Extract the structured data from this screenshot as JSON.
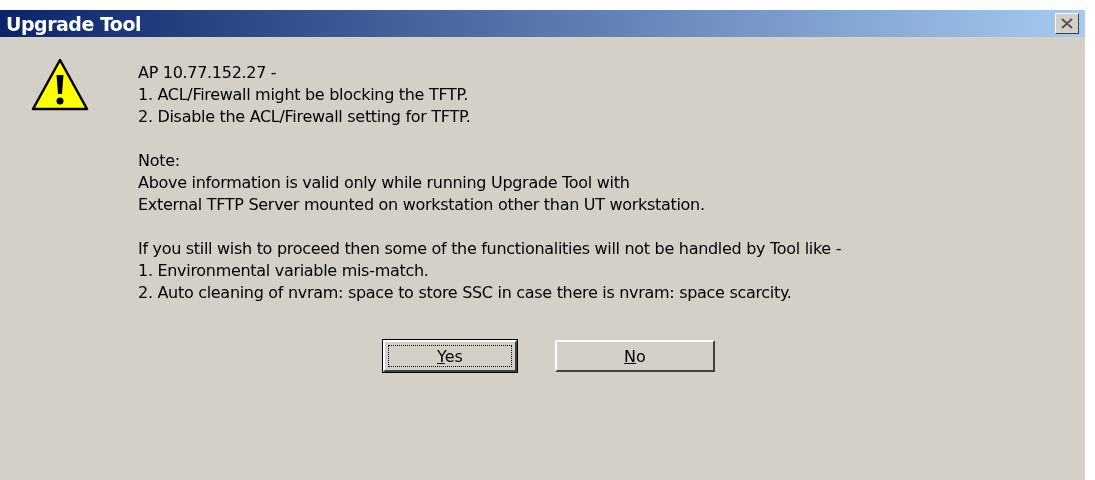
{
  "window": {
    "title": "Upgrade Tool"
  },
  "message": {
    "paragraphs": [
      [
        "AP 10.77.152.27 -",
        "1. ACL/Firewall might be blocking the TFTP.",
        "2. Disable the ACL/Firewall setting for TFTP."
      ],
      [
        "Note:",
        "Above information is valid only while running Upgrade Tool with",
        "External TFTP Server mounted on workstation other than UT workstation."
      ],
      [
        "If you still wish to proceed then some of the functionalities will not be handled by Tool like -",
        "1. Environmental variable mis-match.",
        "2. Auto cleaning of nvram: space to store SSC in case there is nvram: space scarcity."
      ]
    ]
  },
  "buttons": [
    {
      "mnemonic": "Y",
      "rest": "es",
      "default": true
    },
    {
      "mnemonic": "N",
      "rest": "o",
      "default": false
    }
  ]
}
